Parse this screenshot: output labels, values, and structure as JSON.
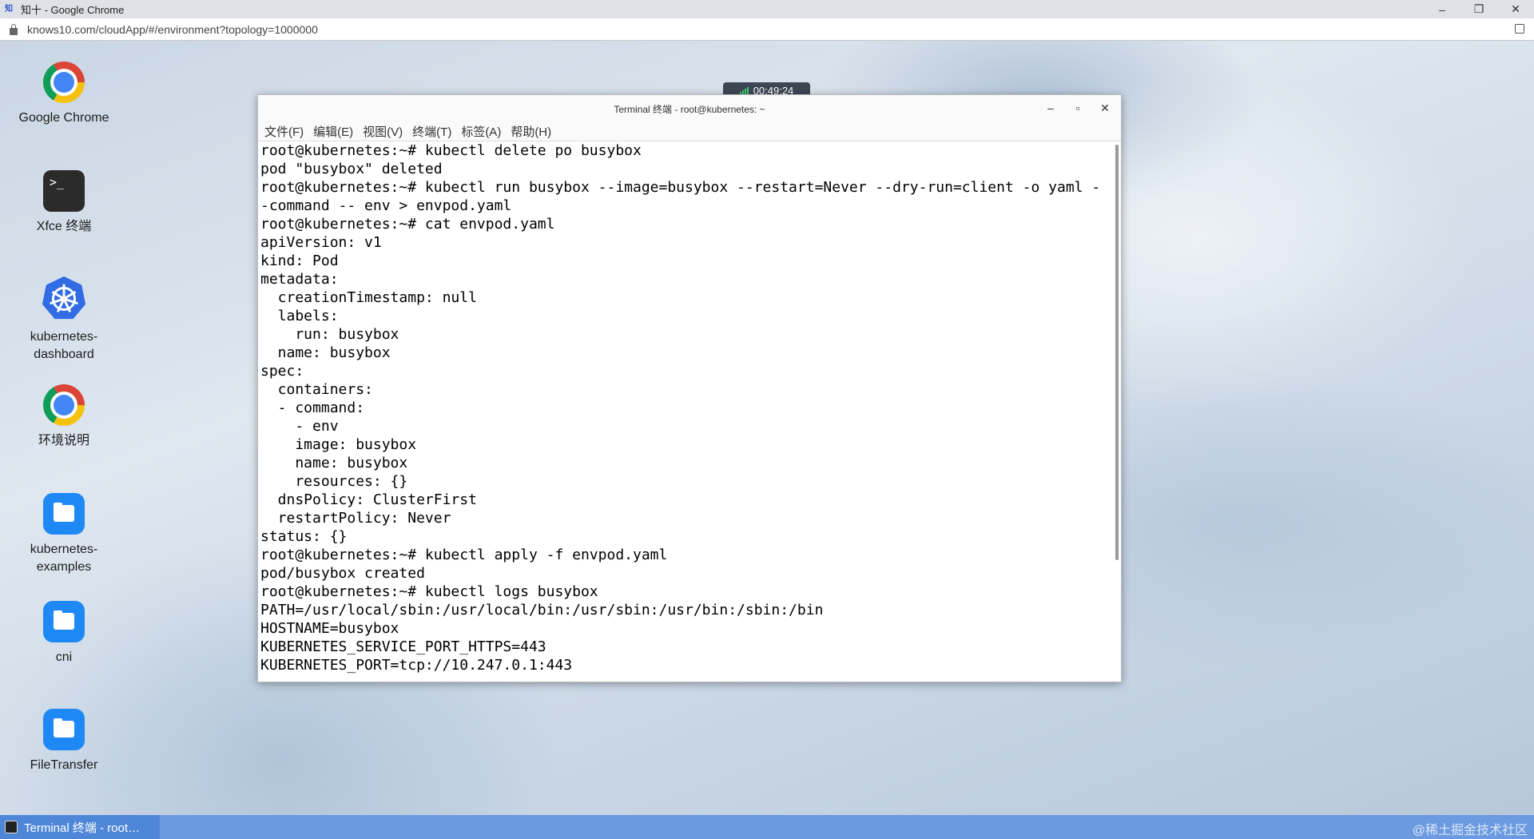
{
  "browser": {
    "tab_title": "知十 - Google Chrome",
    "url": "knows10.com/cloudApp/#/environment?topology=1000000"
  },
  "session": {
    "timer": "00:49:24"
  },
  "desktop_icons": [
    {
      "label": "Google Chrome",
      "icon": "chrome-icon"
    },
    {
      "label": "Xfce 终端",
      "icon": "terminal-icon"
    },
    {
      "label_line1": "kubernetes-",
      "label_line2": "dashboard",
      "icon": "kubernetes-icon"
    },
    {
      "label": "环境说明",
      "icon": "chrome-icon"
    },
    {
      "label_line1": "kubernetes-",
      "label_line2": "examples",
      "icon": "folder-icon"
    },
    {
      "label": "cni",
      "icon": "folder-icon"
    },
    {
      "label": "FileTransfer",
      "icon": "folder-icon"
    }
  ],
  "terminal": {
    "title": "Terminal 终端 - root@kubernetes: ~",
    "menu": [
      "文件(F)",
      "编辑(E)",
      "视图(V)",
      "终端(T)",
      "标签(A)",
      "帮助(H)"
    ],
    "lines": [
      "root@kubernetes:~# kubectl delete po busybox",
      "pod \"busybox\" deleted",
      "root@kubernetes:~# kubectl run busybox --image=busybox --restart=Never --dry-run=client -o yaml -",
      "-command -- env > envpod.yaml",
      "root@kubernetes:~# cat envpod.yaml",
      "apiVersion: v1",
      "kind: Pod",
      "metadata:",
      "  creationTimestamp: null",
      "  labels:",
      "    run: busybox",
      "  name: busybox",
      "spec:",
      "  containers:",
      "  - command:",
      "    - env",
      "    image: busybox",
      "    name: busybox",
      "    resources: {}",
      "  dnsPolicy: ClusterFirst",
      "  restartPolicy: Never",
      "status: {}",
      "root@kubernetes:~# kubectl apply -f envpod.yaml",
      "pod/busybox created",
      "root@kubernetes:~# kubectl logs busybox",
      "PATH=/usr/local/sbin:/usr/local/bin:/usr/sbin:/usr/bin:/sbin:/bin",
      "HOSTNAME=busybox",
      "KUBERNETES_SERVICE_PORT_HTTPS=443",
      "KUBERNETES_PORT=tcp://10.247.0.1:443"
    ]
  },
  "taskbar": {
    "item": "Terminal 终端 - root…",
    "watermark": "@稀土掘金技术社区"
  }
}
